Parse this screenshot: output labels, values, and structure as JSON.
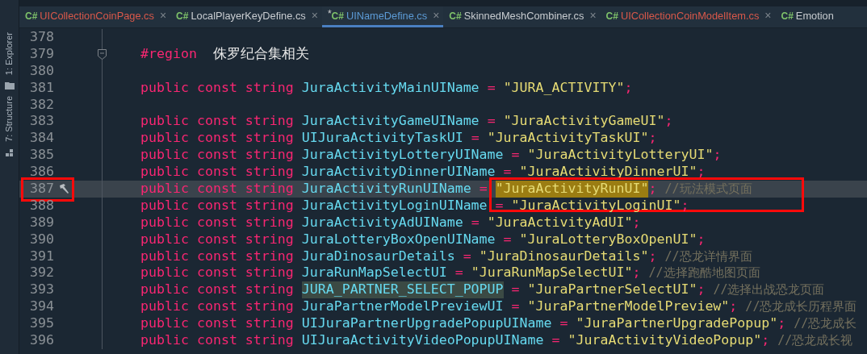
{
  "side_strip": [
    {
      "label": "1: Explorer"
    },
    {
      "label": "7: Structure"
    }
  ],
  "tabs": [
    {
      "badge": "C#",
      "label": "UICollectionCoinPage.cs",
      "error": true,
      "selected": false,
      "close": "×"
    },
    {
      "badge": "C#",
      "label": "LocalPlayerKeyDefine.cs",
      "error": false,
      "selected": false,
      "close": "×"
    },
    {
      "badge": "C#",
      "label": "UINameDefine.cs",
      "mod_mark": "*",
      "error": false,
      "selected": true,
      "close": "×"
    },
    {
      "badge": "C#",
      "label": "SkinnedMeshCombiner.cs",
      "error": false,
      "selected": false,
      "close": "×"
    },
    {
      "badge": "C#",
      "label": "UICollectionCoinModelItem.cs",
      "error": true,
      "selected": false,
      "close": "×"
    },
    {
      "badge": "C#",
      "label": "Emotion",
      "error": false,
      "selected": false
    }
  ],
  "lines": [
    {
      "number": "378",
      "current": false
    },
    {
      "number": "379",
      "current": false,
      "fold": true,
      "segments": [
        {
          "kind": "directive",
          "text": "#region"
        },
        {
          "kind": "plain",
          "text": " 侏罗纪合集相关"
        }
      ]
    },
    {
      "number": "380",
      "current": false
    },
    {
      "number": "381",
      "current": false,
      "segments": [
        {
          "kind": "keyword",
          "text": "public const string"
        },
        {
          "kind": "ident",
          "text": "JuraActivityMainUIName"
        },
        {
          "kind": "op",
          "text": "="
        },
        {
          "kind": "string",
          "text": "\"JURA_ACTIVITY\""
        },
        {
          "kind": "op",
          "text": ";"
        }
      ]
    },
    {
      "number": "382",
      "current": false
    },
    {
      "number": "383",
      "current": false,
      "segments": [
        {
          "kind": "keyword",
          "text": "public const string"
        },
        {
          "kind": "ident",
          "text": "JuraActivityGameUIName"
        },
        {
          "kind": "op",
          "text": "="
        },
        {
          "kind": "string",
          "text": "\"JuraActivityGameUI\""
        },
        {
          "kind": "op",
          "text": ";"
        }
      ]
    },
    {
      "number": "384",
      "current": false,
      "segments": [
        {
          "kind": "keyword",
          "text": "public const string"
        },
        {
          "kind": "ident",
          "text": "UIJuraActivityTaskUI"
        },
        {
          "kind": "op",
          "text": "="
        },
        {
          "kind": "string",
          "text": "\"JuraActivityTaskUI\""
        },
        {
          "kind": "op",
          "text": ";"
        }
      ]
    },
    {
      "number": "385",
      "current": false,
      "segments": [
        {
          "kind": "keyword",
          "text": "public const string"
        },
        {
          "kind": "ident",
          "text": "JuraActivityLotteryUIName"
        },
        {
          "kind": "op",
          "text": "="
        },
        {
          "kind": "string",
          "text": "\"JuraActivityLotteryUI\""
        },
        {
          "kind": "op",
          "text": ";"
        }
      ]
    },
    {
      "number": "386",
      "current": false,
      "segments": [
        {
          "kind": "keyword",
          "text": "public const string"
        },
        {
          "kind": "ident",
          "text": "JuraActivityDinnerUIName"
        },
        {
          "kind": "op",
          "text": "="
        },
        {
          "kind": "string",
          "text": "\"JuraActivityDinnerUI\""
        },
        {
          "kind": "op",
          "text": ";"
        }
      ]
    },
    {
      "number": "387",
      "current": true,
      "annotated": true,
      "segments": [
        {
          "kind": "keyword",
          "text": "public const string"
        },
        {
          "kind": "ident",
          "text": "JuraActivityRunUIName"
        },
        {
          "kind": "op",
          "text": "="
        },
        {
          "kind": "string",
          "text": "\"JuraActivityRunUI\"",
          "selected": true
        },
        {
          "kind": "op",
          "text": ";"
        },
        {
          "kind": "comment",
          "text": "//玩法模式页面"
        }
      ]
    },
    {
      "number": "388",
      "current": false,
      "segments": [
        {
          "kind": "keyword",
          "text": "public const string"
        },
        {
          "kind": "ident",
          "text": "JuraActivityLoginUIName"
        },
        {
          "kind": "op",
          "text": "="
        },
        {
          "kind": "string",
          "text": "\"JuraActivityLoginUI\""
        },
        {
          "kind": "op",
          "text": ";"
        }
      ]
    },
    {
      "number": "389",
      "current": false,
      "segments": [
        {
          "kind": "keyword",
          "text": "public const string"
        },
        {
          "kind": "ident",
          "text": "JuraActivityAdUIName"
        },
        {
          "kind": "op",
          "text": "="
        },
        {
          "kind": "string",
          "text": "\"JuraActivityAdUI\""
        },
        {
          "kind": "op",
          "text": ";"
        }
      ]
    },
    {
      "number": "390",
      "current": false,
      "segments": [
        {
          "kind": "keyword",
          "text": "public const string"
        },
        {
          "kind": "ident",
          "text": "JuraLotteryBoxOpenUIName"
        },
        {
          "kind": "op",
          "text": "="
        },
        {
          "kind": "string",
          "text": "\"JuraLotteryBoxOpenUI\""
        },
        {
          "kind": "op",
          "text": ";"
        }
      ]
    },
    {
      "number": "391",
      "current": false,
      "segments": [
        {
          "kind": "keyword",
          "text": "public const string"
        },
        {
          "kind": "ident",
          "text": "JuraDinosaurDetails"
        },
        {
          "kind": "op",
          "text": "="
        },
        {
          "kind": "string",
          "text": "\"JuraDinosaurDetails\""
        },
        {
          "kind": "op",
          "text": ";"
        },
        {
          "kind": "comment",
          "text": "//恐龙详情界面"
        }
      ]
    },
    {
      "number": "392",
      "current": false,
      "segments": [
        {
          "kind": "keyword",
          "text": "public const string"
        },
        {
          "kind": "ident",
          "text": "JuraRunMapSelectUI"
        },
        {
          "kind": "op",
          "text": "="
        },
        {
          "kind": "string",
          "text": "\"JuraRunMapSelectUI\""
        },
        {
          "kind": "op",
          "text": ";"
        },
        {
          "kind": "comment",
          "text": "//选择跑酷地图页面"
        }
      ]
    },
    {
      "number": "393",
      "current": false,
      "segments": [
        {
          "kind": "keyword",
          "text": "public const string"
        },
        {
          "kind": "ident",
          "text": "JURA_PARTNER_SELECT_POPUP",
          "highlighted": true
        },
        {
          "kind": "op",
          "text": "="
        },
        {
          "kind": "string",
          "text": "\"JuraPartnerSelectUI\""
        },
        {
          "kind": "op",
          "text": ";"
        },
        {
          "kind": "comment",
          "text": "//选择出战恐龙页面"
        }
      ]
    },
    {
      "number": "394",
      "current": false,
      "segments": [
        {
          "kind": "keyword",
          "text": "public const string"
        },
        {
          "kind": "ident",
          "text": "JuraPartnerModelPreviewUI"
        },
        {
          "kind": "op",
          "text": "="
        },
        {
          "kind": "string",
          "text": "\"JuraPartnerModelPreview\""
        },
        {
          "kind": "op",
          "text": ";"
        },
        {
          "kind": "comment",
          "text": "//恐龙成长历程界面"
        }
      ]
    },
    {
      "number": "395",
      "current": false,
      "segments": [
        {
          "kind": "keyword",
          "text": "public const string"
        },
        {
          "kind": "ident",
          "text": "UIJuraPartnerUpgradePopupUIName"
        },
        {
          "kind": "op",
          "text": "="
        },
        {
          "kind": "string",
          "text": "\"JuraPartnerUpgradePopup\""
        },
        {
          "kind": "op",
          "text": ";"
        },
        {
          "kind": "comment",
          "text": "//恐龙成长"
        }
      ]
    },
    {
      "number": "396",
      "current": false,
      "segments": [
        {
          "kind": "keyword",
          "text": "public const string"
        },
        {
          "kind": "ident",
          "text": "UIJuraActivityVideoPopupUIName"
        },
        {
          "kind": "op",
          "text": "="
        },
        {
          "kind": "string",
          "text": "\"JuraActivityVideoPopup\""
        },
        {
          "kind": "op",
          "text": ";"
        },
        {
          "kind": "comment",
          "text": "//恐龙成长视"
        }
      ]
    }
  ]
}
